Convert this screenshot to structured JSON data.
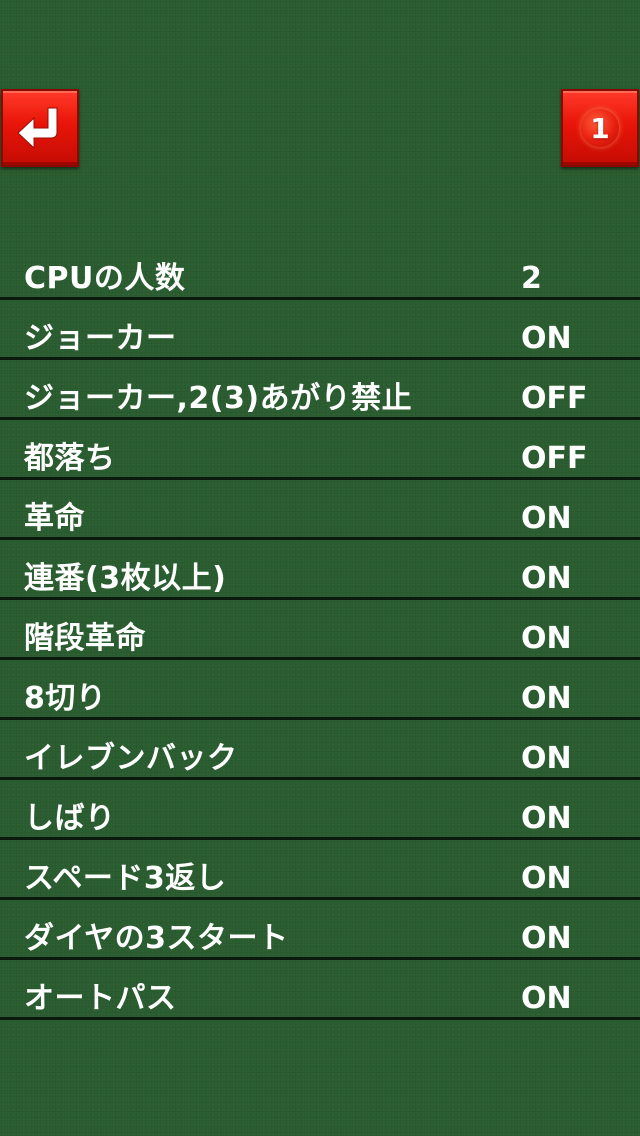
{
  "buttons": {
    "back_icon": "return-arrow-icon",
    "page_number": "1"
  },
  "colors": {
    "felt_green": "#2b5e31",
    "button_red": "#e81508",
    "divider": "#0b1a0d",
    "text": "#ffffff"
  },
  "settings": [
    {
      "label": "CPUの人数",
      "value": "2"
    },
    {
      "label": "ジョーカー",
      "value": "ON"
    },
    {
      "label": "ジョーカー,2(3)あがり禁止",
      "value": "OFF"
    },
    {
      "label": "都落ち",
      "value": "OFF"
    },
    {
      "label": "革命",
      "value": "ON"
    },
    {
      "label": "連番(3枚以上)",
      "value": "ON"
    },
    {
      "label": "階段革命",
      "value": "ON"
    },
    {
      "label": "8切り",
      "value": "ON"
    },
    {
      "label": "イレブンバック",
      "value": "ON"
    },
    {
      "label": "しばり",
      "value": "ON"
    },
    {
      "label": "スペード3返し",
      "value": "ON"
    },
    {
      "label": "ダイヤの3スタート",
      "value": "ON"
    },
    {
      "label": "オートパス",
      "value": "ON"
    }
  ]
}
